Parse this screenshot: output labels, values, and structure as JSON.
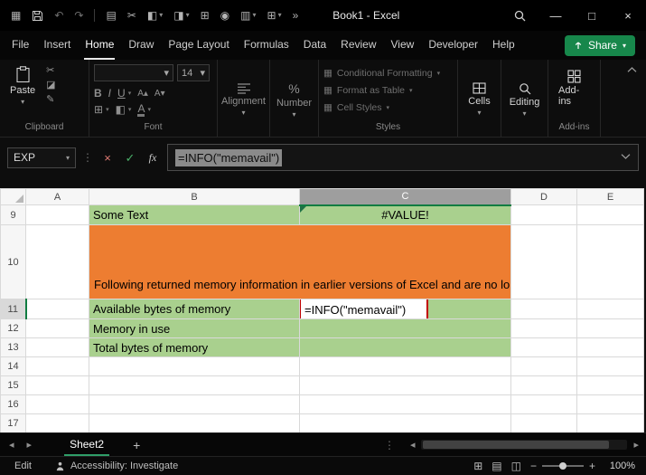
{
  "titlebar": {
    "title": "Book1 - Excel"
  },
  "icons": {
    "app": "▦",
    "undo": "↶",
    "redo": "↷",
    "notebook": "▤",
    "cut": "✂",
    "copy": "◪",
    "painter": "✎",
    "shade1": "◧",
    "shade2": "◨",
    "borders": "⊞",
    "camera": "◉",
    "table": "▥",
    "grid2": "⊞",
    "overflow": "»",
    "dropdown": "▾",
    "cancel": "×",
    "enter": "✓",
    "dots": "⋮",
    "bold": "B",
    "italic": "I",
    "underline": "U",
    "font_bigger": "A▴",
    "font_smaller": "A▾",
    "fontcolor": "A",
    "percent": "%",
    "minimize": "—",
    "maximize": "□",
    "close": "×",
    "nav_left": "◂",
    "nav_right": "▸",
    "scroll_left": "◂",
    "scroll_right": "▸",
    "styles_glyph": "▦",
    "view_normal": "⊞",
    "view_layout": "▤",
    "view_break": "◫",
    "zoom_out": "−",
    "zoom_in": "+"
  },
  "menu": {
    "tabs": [
      "File",
      "Insert",
      "Home",
      "Draw",
      "Page Layout",
      "Formulas",
      "Data",
      "Review",
      "View",
      "Developer",
      "Help"
    ],
    "share": "Share"
  },
  "ribbon": {
    "clipboard": {
      "paste": "Paste",
      "label": "Clipboard"
    },
    "font": {
      "size": "14",
      "label": "Font"
    },
    "alignment": {
      "label": "Alignment"
    },
    "number": {
      "label": "Number"
    },
    "styles": {
      "items": [
        "Conditional Formatting",
        "Format as Table",
        "Cell Styles"
      ],
      "label": "Styles"
    },
    "cells": {
      "label": "Cells"
    },
    "editing": {
      "label": "Editing"
    },
    "addins": {
      "button": "Add-ins",
      "label": "Add-ins"
    }
  },
  "formula_bar": {
    "name_box": "EXP",
    "fx": "fx",
    "formula": "=INFO(\"memavail\")"
  },
  "grid": {
    "col_headers": [
      "A",
      "B",
      "C",
      "D",
      "E"
    ],
    "row_headers": [
      "9",
      "10",
      "11",
      "12",
      "13",
      "14",
      "15",
      "16",
      "17"
    ],
    "active_cell_column": "C",
    "cells": {
      "b9": "Some Text",
      "c9": "#VALUE!",
      "note10": "Following returned memory information in earlier versions of Excel and are no longer supported",
      "b11": "Available bytes of memory",
      "c11": "=INFO(\"memavail\")",
      "b12": "Memory in use",
      "b13": "Total bytes of memory"
    },
    "colors": {
      "green": "#a9d08e",
      "orange": "#ed7d31",
      "edit_border": "#c00000",
      "header_accent": "#107c41"
    }
  },
  "sheet_bar": {
    "active_tab": "Sheet2",
    "add_label": "+"
  },
  "status_bar": {
    "mode": "Edit",
    "accessibility": "Accessibility: Investigate",
    "zoom": "100%"
  }
}
